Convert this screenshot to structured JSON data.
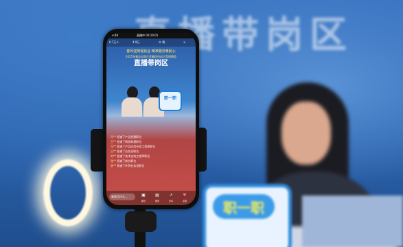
{
  "backdrop": {
    "title": "直播带岗区",
    "sign_text": "职一职"
  },
  "phone": {
    "status_bar": {
      "time": "9:48",
      "live_timer": "直播中 00:19:05"
    },
    "top_bar": {
      "viewers": "0.7万人",
      "likes": "4.9万",
      "mode": "众 将"
    },
    "banner": {
      "line1": "春风送岗促就业 精准服务暖民心",
      "line2": "2025年青岛自贸片区春风行动大型招聘会",
      "title": "直播带岗区"
    },
    "card_text": "职一职",
    "comments": [
      {
        "name": "冯**",
        "text": "投递了产品经理职位"
      },
      {
        "name": "王**",
        "text": "投递了研发助理职位"
      },
      {
        "name": "冯**",
        "text": "投递了产品应用开发工程师职位"
      },
      {
        "name": "王**",
        "text": "投递了业务员职位"
      },
      {
        "name": "刘**",
        "text": "投递了技术支持工程师职位"
      },
      {
        "name": "张**",
        "text": "投递了前台职位"
      },
      {
        "name": "李**",
        "text": "投递了外贸业务员职位"
      }
    ],
    "bottom_bar": {
      "input_placeholder": "来说点什么...",
      "actions": [
        {
          "label": "职位",
          "icon": "briefcase-icon"
        },
        {
          "label": "简历",
          "icon": "resume-icon"
        },
        {
          "label": "分享",
          "icon": "share-icon"
        },
        {
          "label": "点赞",
          "icon": "heart-icon"
        }
      ]
    }
  }
}
